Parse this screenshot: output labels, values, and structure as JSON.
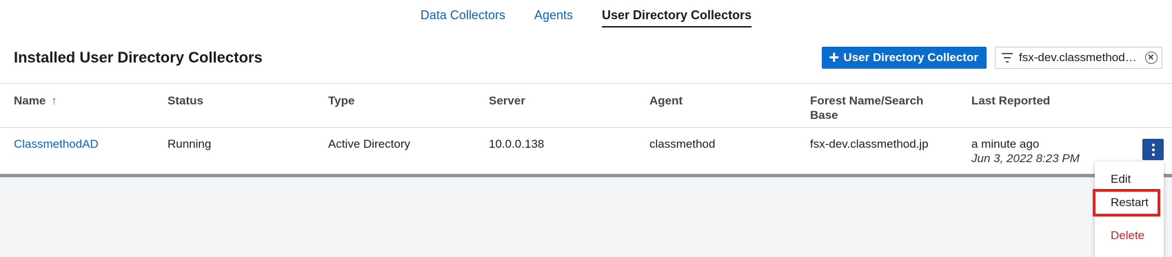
{
  "tabs": [
    {
      "label": "Data Collectors",
      "active": false
    },
    {
      "label": "Agents",
      "active": false
    },
    {
      "label": "User Directory Collectors",
      "active": true
    }
  ],
  "header": {
    "title": "Installed User Directory Collectors",
    "add_button_label": "User Directory Collector",
    "filter_value": "fsx-dev.classmethod…"
  },
  "table": {
    "columns": [
      "Name",
      "Status",
      "Type",
      "Server",
      "Agent",
      "Forest Name/Search Base",
      "Last Reported"
    ],
    "rows": [
      {
        "name": "ClassmethodAD",
        "status": "Running",
        "type": "Active Directory",
        "server": "10.0.0.138",
        "agent": "classmethod",
        "forest": "fsx-dev.classmethod.jp",
        "last_reported": "a minute ago",
        "last_reported_time": "Jun 3, 2022 8:23 PM"
      }
    ]
  },
  "menu": {
    "edit": "Edit",
    "restart": "Restart",
    "delete": "Delete"
  },
  "colors": {
    "accent": "#0a6ccd",
    "link": "#0a63b7",
    "highlight": "#e2231a",
    "danger": "#c8202b"
  }
}
